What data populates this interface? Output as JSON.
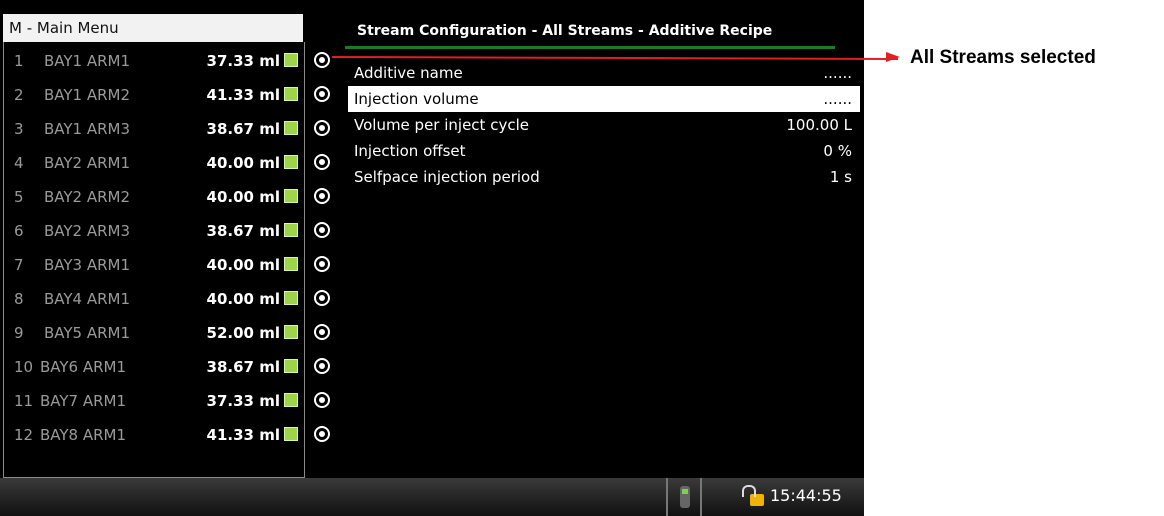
{
  "menu": {
    "title": "M - Main Menu"
  },
  "streams": [
    {
      "num": "1",
      "name": "BAY1 ARM1",
      "volume": "37.33 ml"
    },
    {
      "num": "2",
      "name": "BAY1 ARM2",
      "volume": "41.33 ml"
    },
    {
      "num": "3",
      "name": "BAY1 ARM3",
      "volume": "38.67 ml"
    },
    {
      "num": "4",
      "name": "BAY2 ARM1",
      "volume": "40.00 ml"
    },
    {
      "num": "5",
      "name": "BAY2 ARM2",
      "volume": "40.00 ml"
    },
    {
      "num": "6",
      "name": "BAY2 ARM3",
      "volume": "38.67 ml"
    },
    {
      "num": "7",
      "name": "BAY3 ARM1",
      "volume": "40.00 ml"
    },
    {
      "num": "8",
      "name": "BAY4 ARM1",
      "volume": "40.00 ml"
    },
    {
      "num": "9",
      "name": "BAY5 ARM1",
      "volume": "52.00 ml"
    },
    {
      "num": "10",
      "name": "BAY6 ARM1",
      "volume": "38.67 ml"
    },
    {
      "num": "11",
      "name": "BAY7 ARM1",
      "volume": "37.33 ml"
    },
    {
      "num": "12",
      "name": "BAY8 ARM1",
      "volume": "41.33 ml"
    }
  ],
  "config": {
    "title": "Stream Configuration - All Streams - Additive Recipe",
    "rows": [
      {
        "label": "Additive name",
        "value": "......"
      },
      {
        "label": "Injection volume",
        "value": "......"
      },
      {
        "label": "Volume per inject cycle",
        "value": "100.00 L"
      },
      {
        "label": "Injection offset",
        "value": "0 %"
      },
      {
        "label": "Selfpace injection period",
        "value": "1 s"
      }
    ]
  },
  "status": {
    "time": "15:44:55"
  },
  "annotation": {
    "text": "All Streams selected"
  },
  "colors": {
    "indicator": "#9ed44a",
    "accent_underline": "#1a7a2a",
    "annotation": "#e02020"
  },
  "icons": {
    "usb": "usb-stick-icon",
    "lock": "padlock-unlocked-icon",
    "radio": "radio-selected-icon"
  }
}
